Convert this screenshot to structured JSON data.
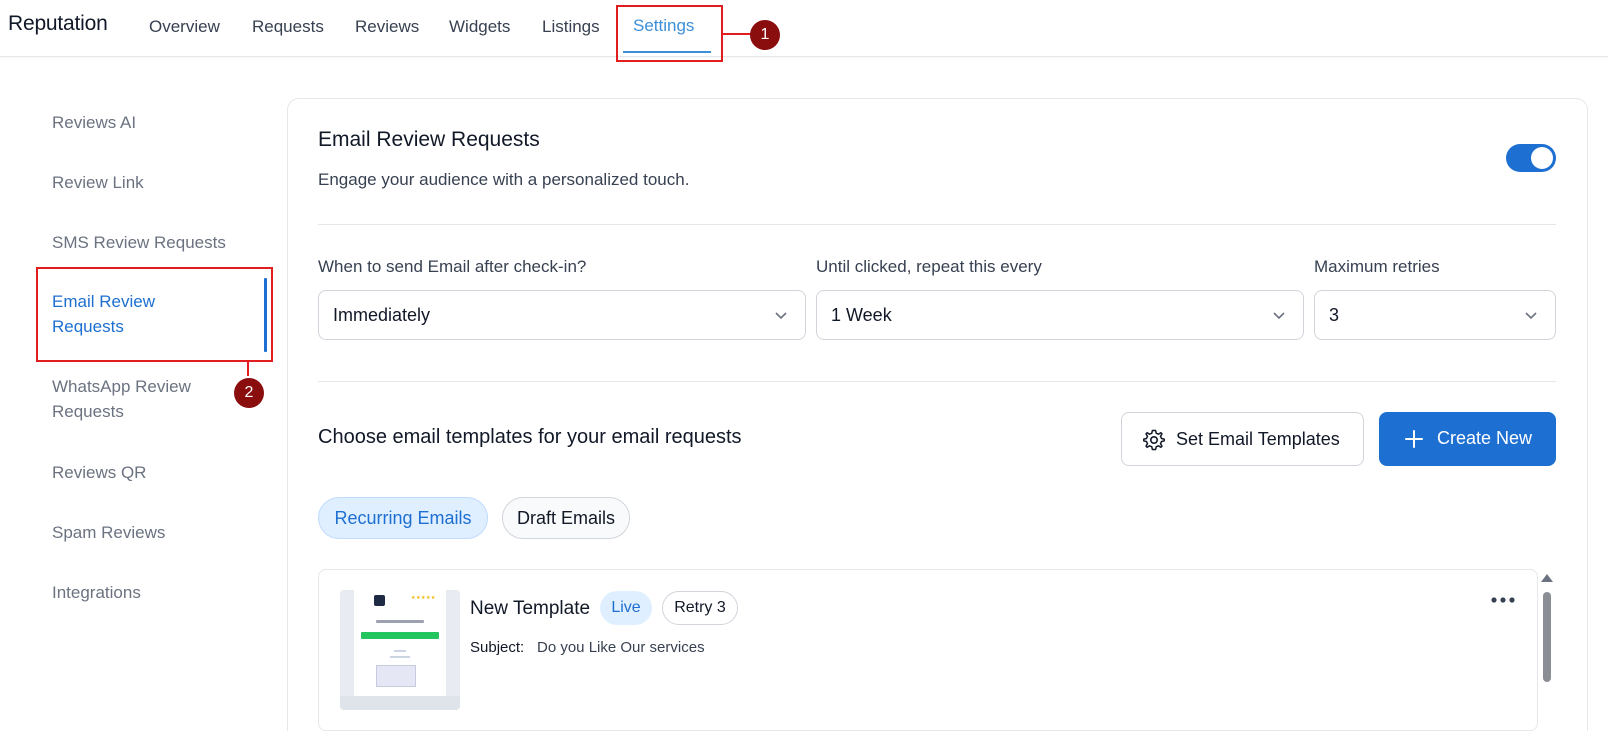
{
  "app": {
    "title": "Reputation"
  },
  "nav": {
    "tabs": [
      {
        "label": "Overview"
      },
      {
        "label": "Requests"
      },
      {
        "label": "Reviews"
      },
      {
        "label": "Widgets"
      },
      {
        "label": "Listings"
      },
      {
        "label": "Settings",
        "active": true
      }
    ]
  },
  "annotations": [
    {
      "number": "1"
    },
    {
      "number": "2"
    }
  ],
  "sidebar": {
    "items": [
      {
        "label": "Reviews AI"
      },
      {
        "label": "Review Link"
      },
      {
        "label": "SMS Review Requests"
      },
      {
        "label": "Email Review Requests",
        "active": true
      },
      {
        "label": "WhatsApp Review Requests"
      },
      {
        "label": "Reviews QR"
      },
      {
        "label": "Spam Reviews"
      },
      {
        "label": "Integrations"
      }
    ]
  },
  "main": {
    "title": "Email Review Requests",
    "subtitle": "Engage your audience with a personalized touch.",
    "enabled": true,
    "fields": [
      {
        "label": "When to send Email after check-in?",
        "value": "Immediately"
      },
      {
        "label": "Until clicked, repeat this every",
        "value": "1 Week"
      },
      {
        "label": "Maximum retries",
        "value": "3"
      }
    ],
    "templates_heading": "Choose email templates for your email requests",
    "set_templates_label": "Set Email Templates",
    "create_new_label": "Create New",
    "filter_tabs": [
      {
        "label": "Recurring Emails",
        "active": true
      },
      {
        "label": "Draft Emails"
      }
    ],
    "template": {
      "name": "New Template",
      "status": "Live",
      "retry": "Retry 3",
      "subject_label": "Subject:",
      "subject_value": "Do you Like Our services"
    }
  },
  "colors": {
    "accent": "#1d6fd1",
    "nav_active": "#3b8fd9",
    "annotation": "#e11d1d"
  }
}
